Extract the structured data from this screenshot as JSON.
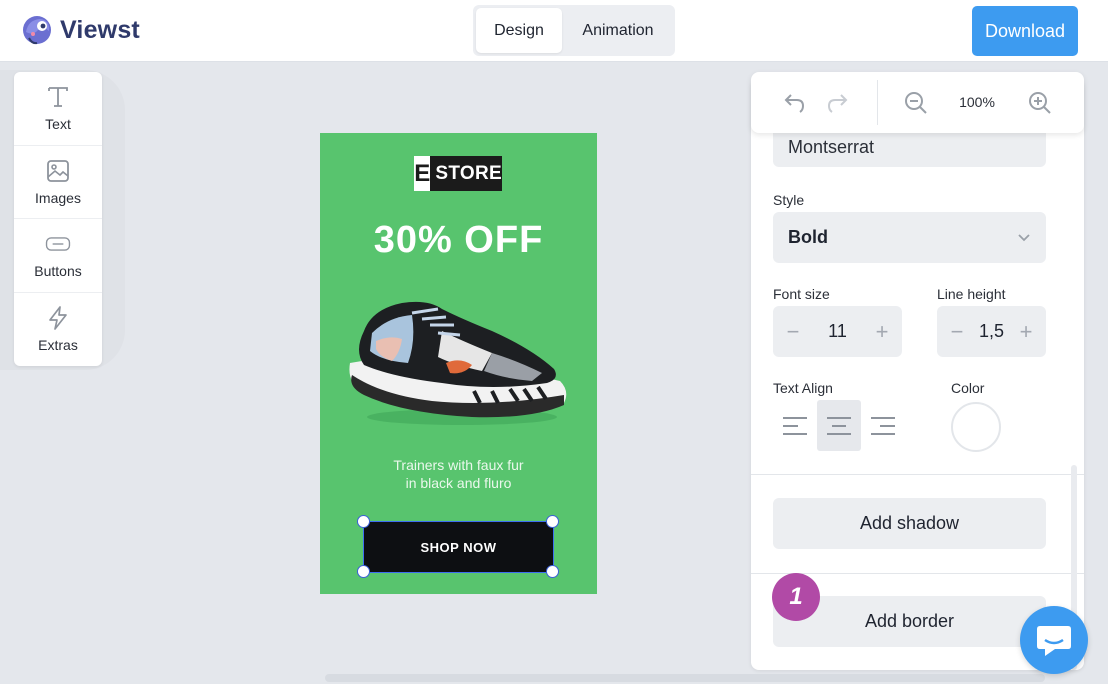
{
  "app": {
    "name": "Viewst"
  },
  "header": {
    "tabs": [
      {
        "label": "Design",
        "active": true
      },
      {
        "label": "Animation",
        "active": false
      }
    ],
    "download_label": "Download"
  },
  "tools": [
    {
      "label": "Text",
      "icon": "text-icon"
    },
    {
      "label": "Images",
      "icon": "image-icon"
    },
    {
      "label": "Buttons",
      "icon": "button-icon"
    },
    {
      "label": "Extras",
      "icon": "lightning-icon"
    }
  ],
  "banner": {
    "store_letter": "E",
    "store_word": "STORE",
    "headline": "30% OFF",
    "description_line1": "Trainers with faux fur",
    "description_line2": "in black and fluro",
    "button_label": "SHOP NOW",
    "background_color": "#58c46e"
  },
  "zoom": {
    "value": "100%"
  },
  "properties": {
    "font_value": "Montserrat",
    "style_label": "Style",
    "style_value": "Bold",
    "font_size_label": "Font size",
    "font_size_value": "11",
    "line_height_label": "Line height",
    "line_height_value": "1,5",
    "text_align_label": "Text Align",
    "text_align_active": "center",
    "color_label": "Color",
    "add_shadow_label": "Add shadow",
    "add_border_label": "Add border"
  },
  "step_badge": "1",
  "colors": {
    "accent": "#3d9bf0",
    "badge": "#b14aa6"
  }
}
